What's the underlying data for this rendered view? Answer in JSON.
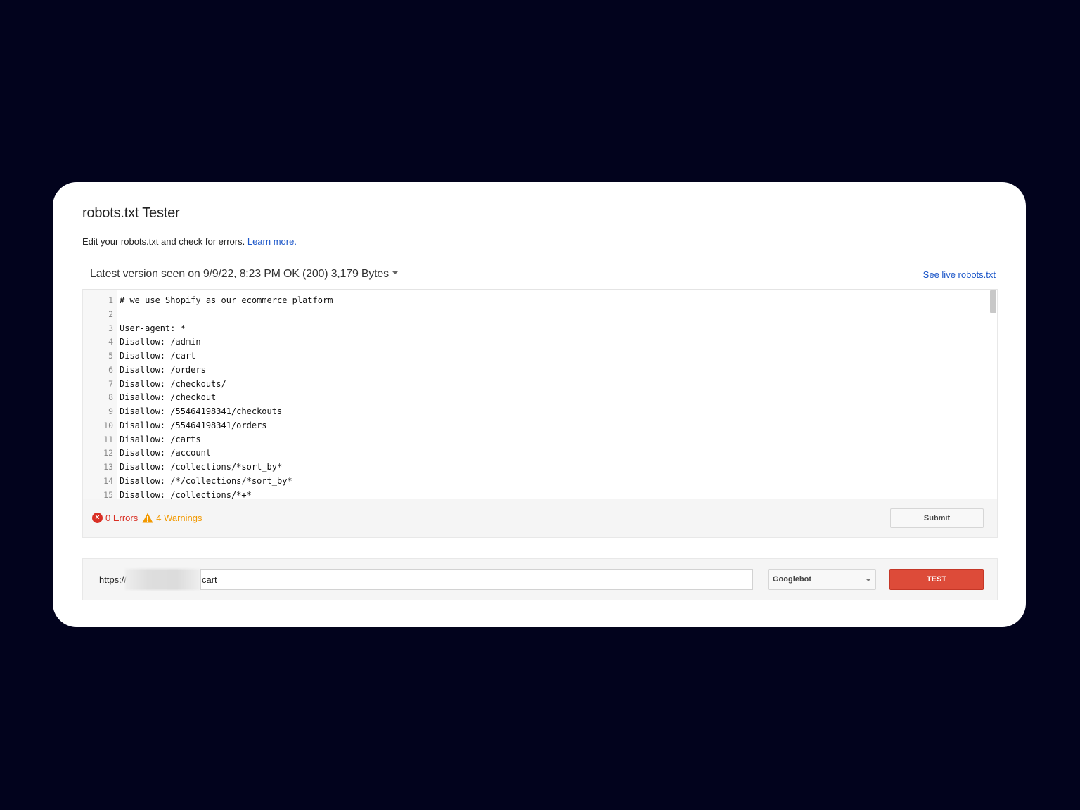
{
  "header": {
    "title": "robots.txt Tester",
    "subtitle": "Edit your robots.txt and check for errors.",
    "learn_more": "Learn more."
  },
  "version": {
    "text": "Latest version seen on 9/9/22, 8:23 PM OK (200) 3,179 Bytes",
    "live_link": "See live robots.txt"
  },
  "editor": {
    "lines": [
      {
        "n": "1",
        "code": "# we use Shopify as our ecommerce platform"
      },
      {
        "n": "2",
        "code": ""
      },
      {
        "n": "3",
        "code": "User-agent: *"
      },
      {
        "n": "4",
        "code": "Disallow: /admin"
      },
      {
        "n": "5",
        "code": "Disallow: /cart"
      },
      {
        "n": "6",
        "code": "Disallow: /orders"
      },
      {
        "n": "7",
        "code": "Disallow: /checkouts/"
      },
      {
        "n": "8",
        "code": "Disallow: /checkout"
      },
      {
        "n": "9",
        "code": "Disallow: /55464198341/checkouts"
      },
      {
        "n": "10",
        "code": "Disallow: /55464198341/orders"
      },
      {
        "n": "11",
        "code": "Disallow: /carts"
      },
      {
        "n": "12",
        "code": "Disallow: /account"
      },
      {
        "n": "13",
        "code": "Disallow: /collections/*sort_by*"
      },
      {
        "n": "14",
        "code": "Disallow: /*/collections/*sort_by*"
      },
      {
        "n": "15",
        "code": "Disallow: /collections/*+*"
      }
    ]
  },
  "status": {
    "errors": "0 Errors",
    "warnings": "4 Warnings",
    "submit_label": "Submit"
  },
  "test": {
    "url_prefix": "https://",
    "url_value": "cart",
    "agent": "Googlebot",
    "test_label": "TEST"
  },
  "colors": {
    "background": "#02031d",
    "link": "#1a55c8",
    "error": "#d93025",
    "warning": "#f29900",
    "test_button": "#dd4b39"
  }
}
